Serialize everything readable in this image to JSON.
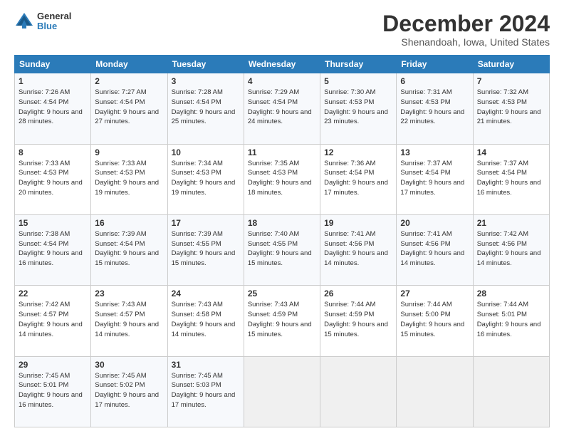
{
  "header": {
    "logo": {
      "general": "General",
      "blue": "Blue"
    },
    "title": "December 2024",
    "location": "Shenandoah, Iowa, United States"
  },
  "calendar": {
    "days_of_week": [
      "Sunday",
      "Monday",
      "Tuesday",
      "Wednesday",
      "Thursday",
      "Friday",
      "Saturday"
    ],
    "weeks": [
      [
        null,
        null,
        {
          "day": "3",
          "sunrise": "Sunrise: 7:28 AM",
          "sunset": "Sunset: 4:54 PM",
          "daylight": "Daylight: 9 hours and 25 minutes."
        },
        {
          "day": "4",
          "sunrise": "Sunrise: 7:29 AM",
          "sunset": "Sunset: 4:54 PM",
          "daylight": "Daylight: 9 hours and 24 minutes."
        },
        {
          "day": "5",
          "sunrise": "Sunrise: 7:30 AM",
          "sunset": "Sunset: 4:53 PM",
          "daylight": "Daylight: 9 hours and 23 minutes."
        },
        {
          "day": "6",
          "sunrise": "Sunrise: 7:31 AM",
          "sunset": "Sunset: 4:53 PM",
          "daylight": "Daylight: 9 hours and 22 minutes."
        },
        {
          "day": "7",
          "sunrise": "Sunrise: 7:32 AM",
          "sunset": "Sunset: 4:53 PM",
          "daylight": "Daylight: 9 hours and 21 minutes."
        }
      ],
      [
        {
          "day": "1",
          "sunrise": "Sunrise: 7:26 AM",
          "sunset": "Sunset: 4:54 PM",
          "daylight": "Daylight: 9 hours and 28 minutes."
        },
        {
          "day": "2",
          "sunrise": "Sunrise: 7:27 AM",
          "sunset": "Sunset: 4:54 PM",
          "daylight": "Daylight: 9 hours and 27 minutes."
        },
        null,
        null,
        null,
        null,
        null
      ],
      [
        {
          "day": "8",
          "sunrise": "Sunrise: 7:33 AM",
          "sunset": "Sunset: 4:53 PM",
          "daylight": "Daylight: 9 hours and 20 minutes."
        },
        {
          "day": "9",
          "sunrise": "Sunrise: 7:33 AM",
          "sunset": "Sunset: 4:53 PM",
          "daylight": "Daylight: 9 hours and 19 minutes."
        },
        {
          "day": "10",
          "sunrise": "Sunrise: 7:34 AM",
          "sunset": "Sunset: 4:53 PM",
          "daylight": "Daylight: 9 hours and 19 minutes."
        },
        {
          "day": "11",
          "sunrise": "Sunrise: 7:35 AM",
          "sunset": "Sunset: 4:53 PM",
          "daylight": "Daylight: 9 hours and 18 minutes."
        },
        {
          "day": "12",
          "sunrise": "Sunrise: 7:36 AM",
          "sunset": "Sunset: 4:54 PM",
          "daylight": "Daylight: 9 hours and 17 minutes."
        },
        {
          "day": "13",
          "sunrise": "Sunrise: 7:37 AM",
          "sunset": "Sunset: 4:54 PM",
          "daylight": "Daylight: 9 hours and 17 minutes."
        },
        {
          "day": "14",
          "sunrise": "Sunrise: 7:37 AM",
          "sunset": "Sunset: 4:54 PM",
          "daylight": "Daylight: 9 hours and 16 minutes."
        }
      ],
      [
        {
          "day": "15",
          "sunrise": "Sunrise: 7:38 AM",
          "sunset": "Sunset: 4:54 PM",
          "daylight": "Daylight: 9 hours and 16 minutes."
        },
        {
          "day": "16",
          "sunrise": "Sunrise: 7:39 AM",
          "sunset": "Sunset: 4:54 PM",
          "daylight": "Daylight: 9 hours and 15 minutes."
        },
        {
          "day": "17",
          "sunrise": "Sunrise: 7:39 AM",
          "sunset": "Sunset: 4:55 PM",
          "daylight": "Daylight: 9 hours and 15 minutes."
        },
        {
          "day": "18",
          "sunrise": "Sunrise: 7:40 AM",
          "sunset": "Sunset: 4:55 PM",
          "daylight": "Daylight: 9 hours and 15 minutes."
        },
        {
          "day": "19",
          "sunrise": "Sunrise: 7:41 AM",
          "sunset": "Sunset: 4:56 PM",
          "daylight": "Daylight: 9 hours and 14 minutes."
        },
        {
          "day": "20",
          "sunrise": "Sunrise: 7:41 AM",
          "sunset": "Sunset: 4:56 PM",
          "daylight": "Daylight: 9 hours and 14 minutes."
        },
        {
          "day": "21",
          "sunrise": "Sunrise: 7:42 AM",
          "sunset": "Sunset: 4:56 PM",
          "daylight": "Daylight: 9 hours and 14 minutes."
        }
      ],
      [
        {
          "day": "22",
          "sunrise": "Sunrise: 7:42 AM",
          "sunset": "Sunset: 4:57 PM",
          "daylight": "Daylight: 9 hours and 14 minutes."
        },
        {
          "day": "23",
          "sunrise": "Sunrise: 7:43 AM",
          "sunset": "Sunset: 4:57 PM",
          "daylight": "Daylight: 9 hours and 14 minutes."
        },
        {
          "day": "24",
          "sunrise": "Sunrise: 7:43 AM",
          "sunset": "Sunset: 4:58 PM",
          "daylight": "Daylight: 9 hours and 14 minutes."
        },
        {
          "day": "25",
          "sunrise": "Sunrise: 7:43 AM",
          "sunset": "Sunset: 4:59 PM",
          "daylight": "Daylight: 9 hours and 15 minutes."
        },
        {
          "day": "26",
          "sunrise": "Sunrise: 7:44 AM",
          "sunset": "Sunset: 4:59 PM",
          "daylight": "Daylight: 9 hours and 15 minutes."
        },
        {
          "day": "27",
          "sunrise": "Sunrise: 7:44 AM",
          "sunset": "Sunset: 5:00 PM",
          "daylight": "Daylight: 9 hours and 15 minutes."
        },
        {
          "day": "28",
          "sunrise": "Sunrise: 7:44 AM",
          "sunset": "Sunset: 5:01 PM",
          "daylight": "Daylight: 9 hours and 16 minutes."
        }
      ],
      [
        {
          "day": "29",
          "sunrise": "Sunrise: 7:45 AM",
          "sunset": "Sunset: 5:01 PM",
          "daylight": "Daylight: 9 hours and 16 minutes."
        },
        {
          "day": "30",
          "sunrise": "Sunrise: 7:45 AM",
          "sunset": "Sunset: 5:02 PM",
          "daylight": "Daylight: 9 hours and 17 minutes."
        },
        {
          "day": "31",
          "sunrise": "Sunrise: 7:45 AM",
          "sunset": "Sunset: 5:03 PM",
          "daylight": "Daylight: 9 hours and 17 minutes."
        },
        null,
        null,
        null,
        null
      ]
    ]
  }
}
